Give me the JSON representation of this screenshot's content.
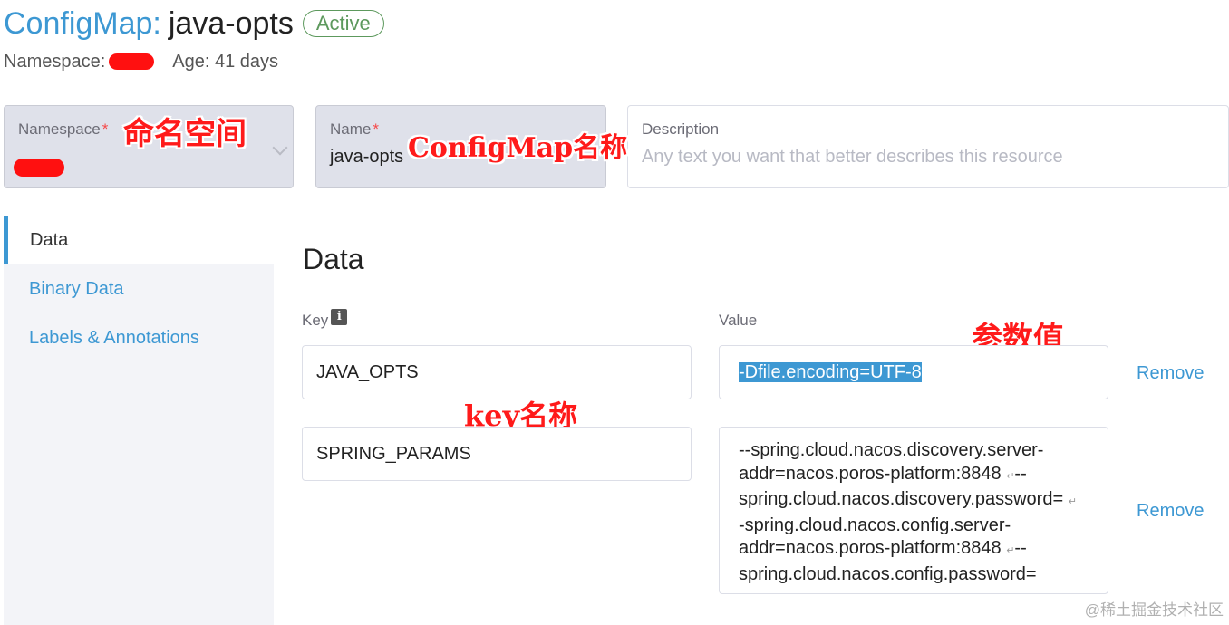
{
  "header": {
    "kind": "ConfigMap:",
    "name": "java-opts",
    "status": "Active",
    "namespace_label": "Namespace:",
    "age": "Age: 41 days"
  },
  "form": {
    "namespace": {
      "label": "Namespace",
      "required": "*"
    },
    "name": {
      "label": "Name",
      "required": "*",
      "value": "java-opts"
    },
    "description": {
      "label": "Description",
      "placeholder": "Any text you want that better describes this resource"
    }
  },
  "sidebar": {
    "items": [
      {
        "label": "Data",
        "active": true
      },
      {
        "label": "Binary Data",
        "active": false
      },
      {
        "label": "Labels & Annotations",
        "active": false
      }
    ]
  },
  "data_section": {
    "title": "Data",
    "key_label": "Key",
    "value_label": "Value",
    "info_icon": "i",
    "rows": [
      {
        "key": "JAVA_OPTS",
        "value": "-Dfile.encoding=UTF-8",
        "remove": "Remove"
      },
      {
        "key": "SPRING_PARAMS",
        "value_lines": [
          "--spring.cloud.nacos.discovery.server-",
          "addr=nacos.poros-platform:8848",
          "--",
          "spring.cloud.nacos.discovery.password=",
          "-spring.cloud.nacos.config.server-",
          "addr=nacos.poros-platform:8848",
          "--",
          "spring.cloud.nacos.config.password="
        ],
        "remove": "Remove"
      }
    ]
  },
  "annotations": {
    "namespace": "命名空间",
    "configmap_name": "ConfigMap名称",
    "param_value": "参数值",
    "key_name": "key名称"
  },
  "watermark": "@稀土掘金技术社区",
  "colors": {
    "accent": "#3d98d3",
    "status_green": "#5d995d",
    "annotation_red": "#ff1a1a"
  },
  "icons": {
    "info": "info-icon",
    "dropdown": "chevron-down-icon",
    "newline": "newline-icon"
  }
}
